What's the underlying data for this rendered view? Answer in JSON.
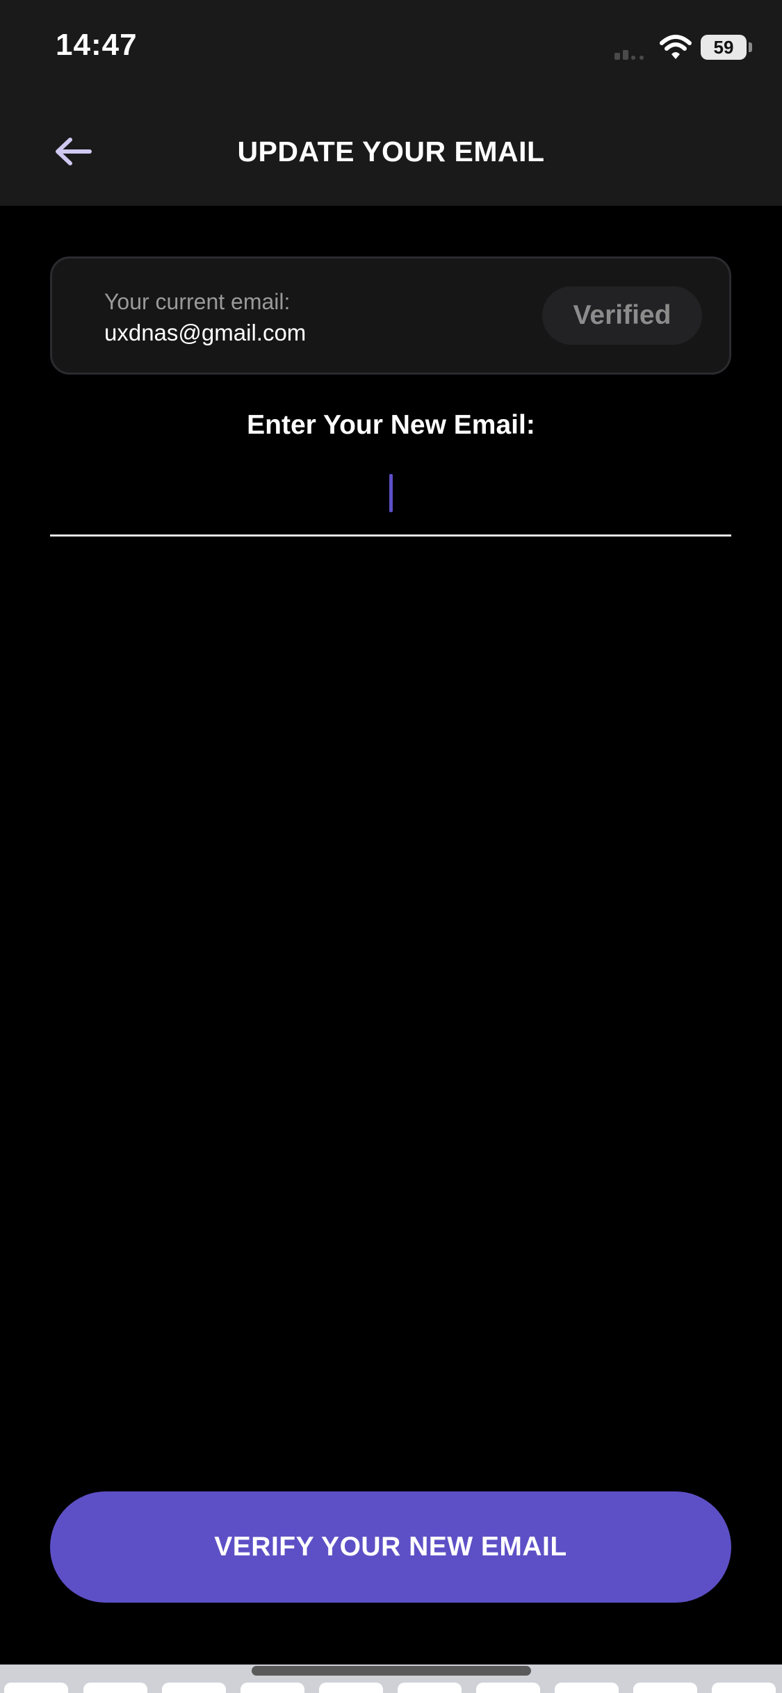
{
  "status_bar": {
    "time": "14:47",
    "battery_level": "59",
    "signal_icon": "cellular-signal-icon",
    "wifi_icon": "wifi-icon"
  },
  "header": {
    "title": "UPDATE YOUR EMAIL",
    "back_icon": "arrow-left-icon"
  },
  "current_email": {
    "label": "Your current email:",
    "value": "uxdnas@gmail.com",
    "badge": "Verified"
  },
  "new_email": {
    "label": "Enter Your New Email:",
    "value": ""
  },
  "verify_button": {
    "label": "VERIFY YOUR NEW EMAIL"
  },
  "colors": {
    "accent": "#5d50c6",
    "background": "#000000",
    "header_bg": "#1a1a1a",
    "card_bg": "#161616",
    "badge_text": "#8c8c8c"
  }
}
